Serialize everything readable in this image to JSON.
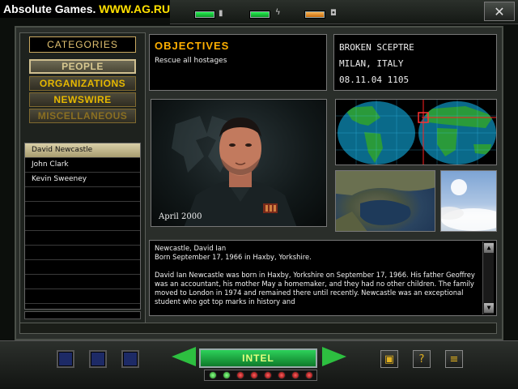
{
  "watermark": {
    "part1": "Absolute Games.",
    "part2": "WWW.AG.RU"
  },
  "topbar": {
    "indicators": [
      {
        "icon": "signal-icon",
        "color": "#2bff5a"
      },
      {
        "icon": "lightning-icon",
        "color": "#2bff5a"
      },
      {
        "icon": "camera-icon",
        "color": "#ffa030"
      }
    ],
    "close_label": "✕"
  },
  "categories": {
    "title": "CATEGORIES",
    "items": [
      "PEOPLE",
      "ORGANIZATIONS",
      "NEWSWIRE",
      "MISCELLANEOUS"
    ],
    "active": "PEOPLE"
  },
  "people": [
    "David Newcastle",
    "John Clark",
    "Kevin Sweeney"
  ],
  "selected_person": "David Newcastle",
  "objectives": {
    "title": "OBJECTIVES",
    "text": "Rescue all hostages"
  },
  "mission": {
    "name": "BROKEN SCEPTRE",
    "location": "MILAN, ITALY",
    "datetime": "08.11.04 1105"
  },
  "portrait": {
    "caption": "April 2000"
  },
  "bio": {
    "heading": "Newcastle, David Ian",
    "born": "Born September 17, 1966 in Haxby, Yorkshire.",
    "body": "David Ian Newcastle was born in Haxby, Yorkshire on September 17, 1966. His father Geoffrey was an accountant, his mother May a homemaker, and they had no other children. The family moved to London in 1974 and remained there until recently. Newcastle was an exceptional student who got top marks in history and"
  },
  "bottom": {
    "intel_label": "INTEL",
    "slots": 3,
    "lights": [
      "green",
      "green",
      "red",
      "red",
      "red",
      "red",
      "red",
      "red"
    ],
    "tools": [
      {
        "icon": "save-disk-icon",
        "glyph": "▣"
      },
      {
        "icon": "help-icon",
        "glyph": "?"
      },
      {
        "icon": "options-icon",
        "glyph": "≡"
      }
    ]
  },
  "colors": {
    "accent_gold": "#e6b800",
    "objectives_orange": "#ffb000",
    "intel_green": "#2dd25a",
    "map_ocean": "#0a6a8a"
  }
}
